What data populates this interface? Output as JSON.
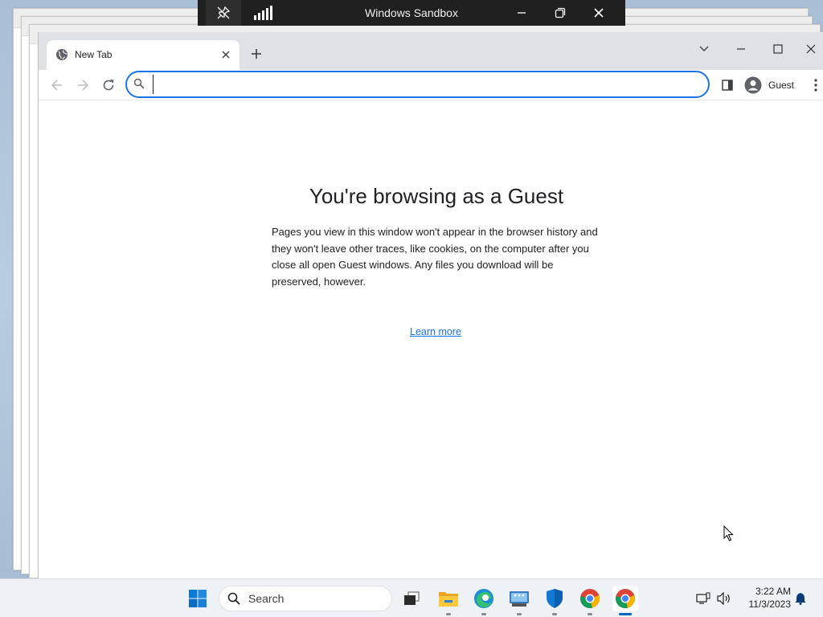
{
  "sandbox": {
    "title": "Windows Sandbox"
  },
  "browser": {
    "tab": {
      "label": "New Tab",
      "favicon": "globe-icon"
    },
    "omnibox": {
      "value": "",
      "placeholder": ""
    },
    "profile": {
      "name": "Guest"
    }
  },
  "page": {
    "heading": "You're browsing as a Guest",
    "description": "Pages you view in this window won't appear in the browser history and they won't leave other traces, like cookies, on the computer after you close all open Guest windows. Any files you download will be preserved, however.",
    "learn_more": "Learn more"
  },
  "taskbar": {
    "search_label": "Search",
    "apps": [
      "start-icon",
      "task-view-icon",
      "file-explorer-icon",
      "edge-icon",
      "network-app-icon",
      "defender-icon",
      "chrome-icon",
      "chrome-active-icon"
    ],
    "time": "3:22 AM",
    "date": "11/3/2023"
  },
  "colors": {
    "accent": "#1a73e8",
    "sandbox_bar": "#202020",
    "tabstrip": "#dee1e6"
  }
}
